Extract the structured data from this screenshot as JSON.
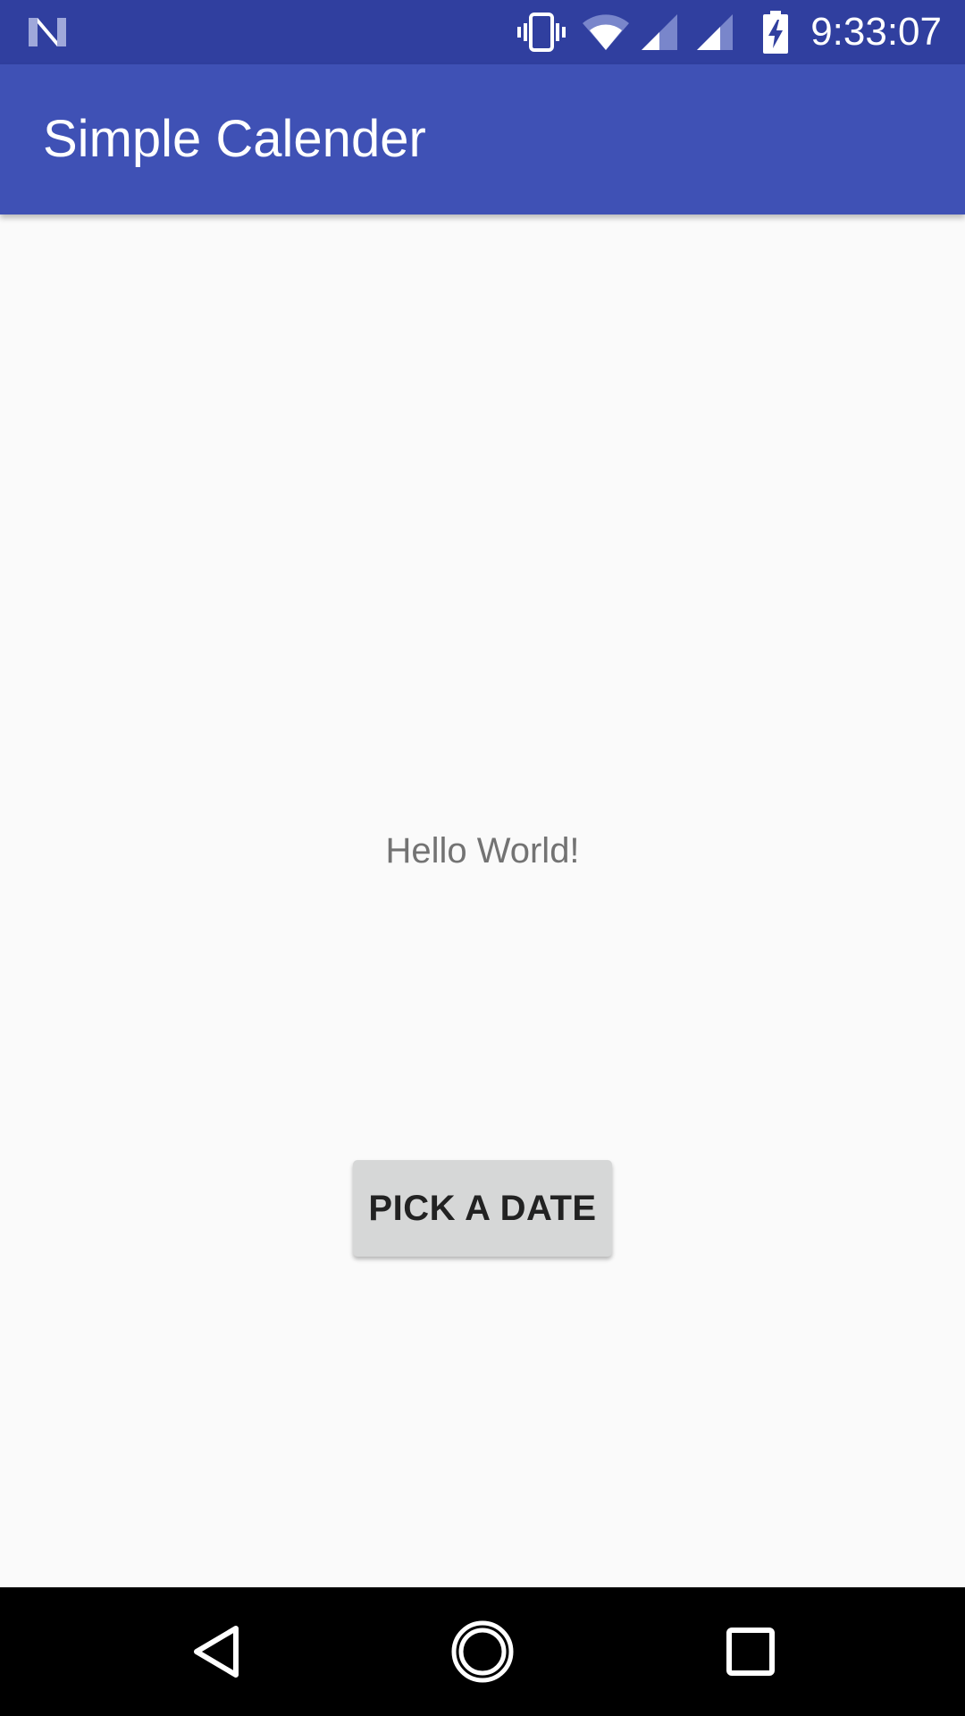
{
  "status_bar": {
    "time": "9:33:07",
    "icons": [
      "notification-n-icon",
      "vibrate-icon",
      "wifi-icon",
      "signal-icon",
      "signal-icon",
      "battery-charging-icon"
    ]
  },
  "app_bar": {
    "title": "Simple Calender"
  },
  "main": {
    "hello_text": "Hello World!",
    "pick_button_label": "PICK A DATE"
  },
  "nav_bar": {
    "buttons": [
      "back-icon",
      "home-icon",
      "recents-icon"
    ]
  },
  "colors": {
    "status_bar": "#303f9f",
    "app_bar": "#3f51b5",
    "background": "#fafafa",
    "button": "#d6d7d7",
    "nav_bar": "#000000"
  }
}
